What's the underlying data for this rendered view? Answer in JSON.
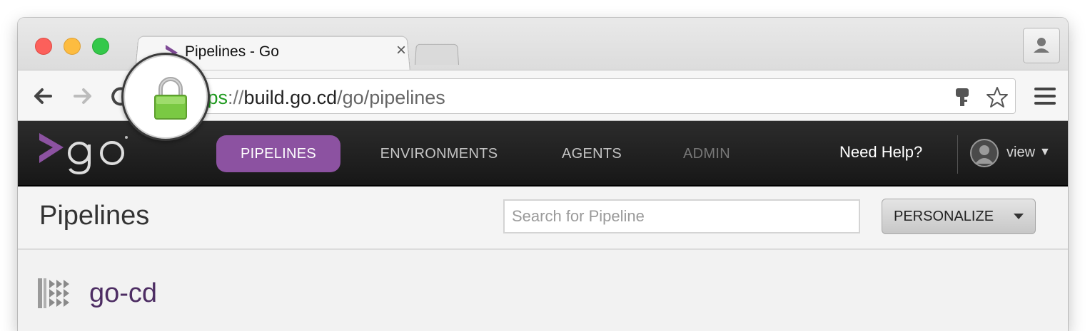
{
  "browser": {
    "tab": {
      "title": "Pipelines - Go",
      "close_glyph": "×"
    },
    "url": {
      "scheme": "https",
      "sep": "://",
      "host": "build.go.cd",
      "path": "/go/pipelines",
      "visible_scheme_fragment": "tps"
    },
    "icons": {
      "back": "arrow-left-icon",
      "forward": "arrow-right-icon",
      "reload": "reload-icon",
      "lock": "lock-icon",
      "key": "key-icon",
      "bookmark": "star-icon",
      "menu": "hamburger-menu-icon",
      "profile": "person-icon"
    }
  },
  "go_header": {
    "logo": "go",
    "nav": [
      {
        "label": "PIPELINES",
        "active": true
      },
      {
        "label": "ENVIRONMENTS",
        "active": false
      },
      {
        "label": "AGENTS",
        "active": false
      },
      {
        "label": "ADMIN",
        "active": false,
        "disabled": true
      }
    ],
    "help": "Need Help?",
    "user": {
      "name": "view"
    },
    "colors": {
      "accent": "#8c52a1",
      "header_bg": "#1f1f1f"
    }
  },
  "page": {
    "title": "Pipelines",
    "search": {
      "placeholder": "Search for Pipeline",
      "value": ""
    },
    "personalize_label": "PERSONALIZE"
  },
  "pipeline_groups": [
    {
      "name": "go-cd"
    }
  ]
}
